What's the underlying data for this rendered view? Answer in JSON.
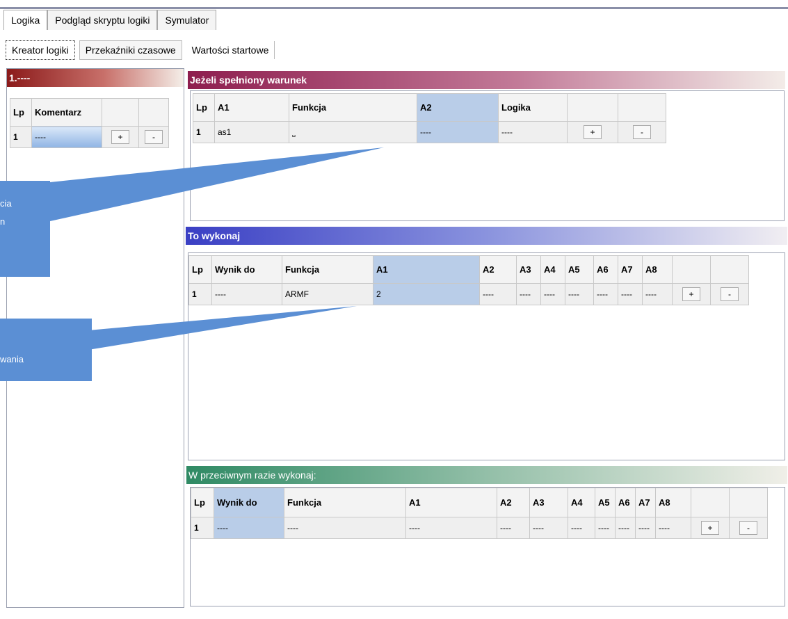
{
  "tabs": [
    "Logika",
    "Podgląd skryptu logiki",
    "Symulator"
  ],
  "subtabs": [
    "Kreator logiki",
    "Przekaźniki czasowe",
    "Wartości startowe"
  ],
  "left_panel": {
    "title": "1.----",
    "headers": [
      "Lp",
      "Komentarz"
    ],
    "row": {
      "lp": "1",
      "komentarz": "----",
      "plus": "+",
      "minus": "-"
    }
  },
  "condition": {
    "title": "Jeżeli spełniony warunek",
    "headers": [
      "Lp",
      "A1",
      "Funkcja",
      "A2",
      "Logika"
    ],
    "row": {
      "lp": "1",
      "a1": "as1",
      "funkcja": "⎵",
      "a2": "----",
      "logika": "----",
      "plus": "+",
      "minus": "-"
    }
  },
  "execute": {
    "title": "To wykonaj",
    "headers": [
      "Lp",
      "Wynik do",
      "Funkcja",
      "A1",
      "A2",
      "A3",
      "A4",
      "A5",
      "A6",
      "A7",
      "A8"
    ],
    "row": [
      "1",
      "----",
      "ARMF",
      "2",
      "----",
      "----",
      "----",
      "----",
      "----",
      "----",
      "----"
    ],
    "plus": "+",
    "minus": "-"
  },
  "else": {
    "title": "W przeciwnym razie wykonaj:",
    "headers": [
      "Lp",
      "Wynik do",
      "Funkcja",
      "A1",
      "A2",
      "A3",
      "A4",
      "A5",
      "A6",
      "A7",
      "A8"
    ],
    "row": [
      "1",
      "----",
      "----",
      "----",
      "----",
      "----",
      "----",
      "----",
      "----",
      "----",
      "----"
    ],
    "plus": "+",
    "minus": "-"
  },
  "callouts": {
    "first": [
      "cia",
      "n"
    ],
    "second": "wania"
  }
}
